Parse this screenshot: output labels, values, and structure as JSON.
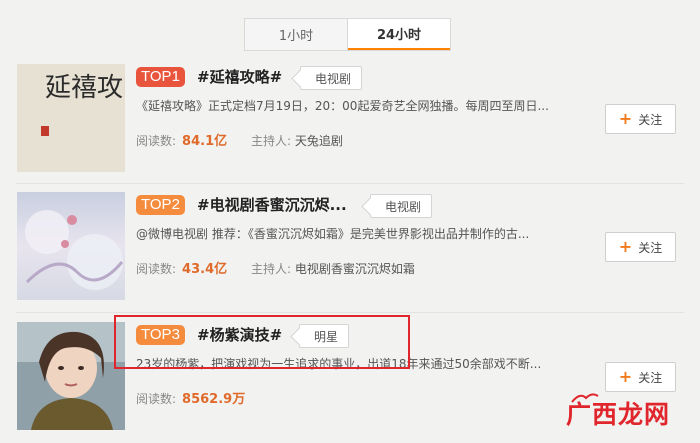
{
  "tabs": [
    {
      "label": "1小时",
      "active": false
    },
    {
      "label": "24小时",
      "active": true
    }
  ],
  "topics": [
    {
      "rank": "TOP1",
      "title": "#延禧攻略#",
      "category": "电视剧",
      "description": "《延禧攻略》正式定档7月19日，20：00起爱奇艺全网独播。每周四至周日...",
      "reads_label": "阅读数:",
      "reads": "84.1亿",
      "host_label": "主持人:",
      "host": "天兔追剧",
      "follow_label": "关注",
      "thumb_text": "延禧攻略"
    },
    {
      "rank": "TOP2",
      "title": "#电视剧香蜜沉沉烬...",
      "category": "电视剧",
      "description": "@微博电视剧 推荐：《香蜜沉沉烬如霜》是完美世界影视出品并制作的古...",
      "reads_label": "阅读数:",
      "reads": "43.4亿",
      "host_label": "主持人:",
      "host": "电视剧香蜜沉沉烬如霜",
      "follow_label": "关注"
    },
    {
      "rank": "TOP3",
      "title": "#杨紫演技#",
      "category": "明星",
      "description": "23岁的杨紫，把演戏视为一生追求的事业，出道18年来通过50余部戏不断...",
      "reads_label": "阅读数:",
      "reads": "8562.9万",
      "follow_label": "关注"
    }
  ],
  "watermark": "广西龙网",
  "colors": {
    "accent": "#ff8200",
    "rank_top1": "#e8543c",
    "rank_other": "#f58b3c",
    "reads": "#e06a2b",
    "highlight": "#e0262c"
  }
}
